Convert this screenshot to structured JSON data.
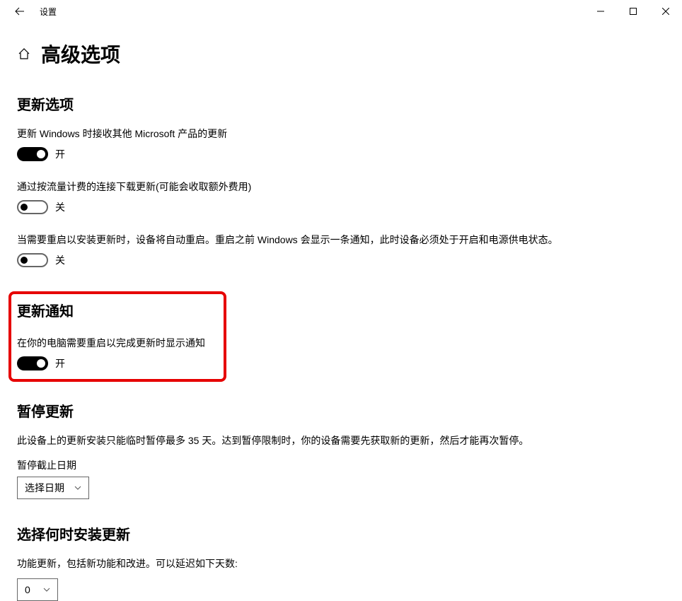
{
  "titlebar": {
    "app_name": "设置"
  },
  "page": {
    "title": "高级选项"
  },
  "sections": {
    "update_options": {
      "title": "更新选项",
      "opt1": {
        "desc": "更新 Windows 时接收其他 Microsoft 产品的更新",
        "state_label": "开",
        "on": true
      },
      "opt2": {
        "desc": "通过按流量计费的连接下载更新(可能会收取额外费用)",
        "state_label": "关",
        "on": false
      },
      "opt3": {
        "desc": "当需要重启以安装更新时，设备将自动重启。重启之前 Windows 会显示一条通知，此时设备必须处于开启和电源供电状态。",
        "state_label": "关",
        "on": false
      }
    },
    "update_notify": {
      "title": "更新通知",
      "desc": "在你的电脑需要重启以完成更新时显示通知",
      "state_label": "开",
      "on": true
    },
    "pause": {
      "title": "暂停更新",
      "desc": "此设备上的更新安装只能临时暂停最多 35 天。达到暂停限制时，你的设备需要先获取新的更新，然后才能再次暂停。",
      "deadline_label": "暂停截止日期",
      "dropdown_label": "选择日期"
    },
    "schedule": {
      "title": "选择何时安装更新",
      "desc": "功能更新，包括新功能和改进。可以延迟如下天数:",
      "value": "0"
    }
  }
}
